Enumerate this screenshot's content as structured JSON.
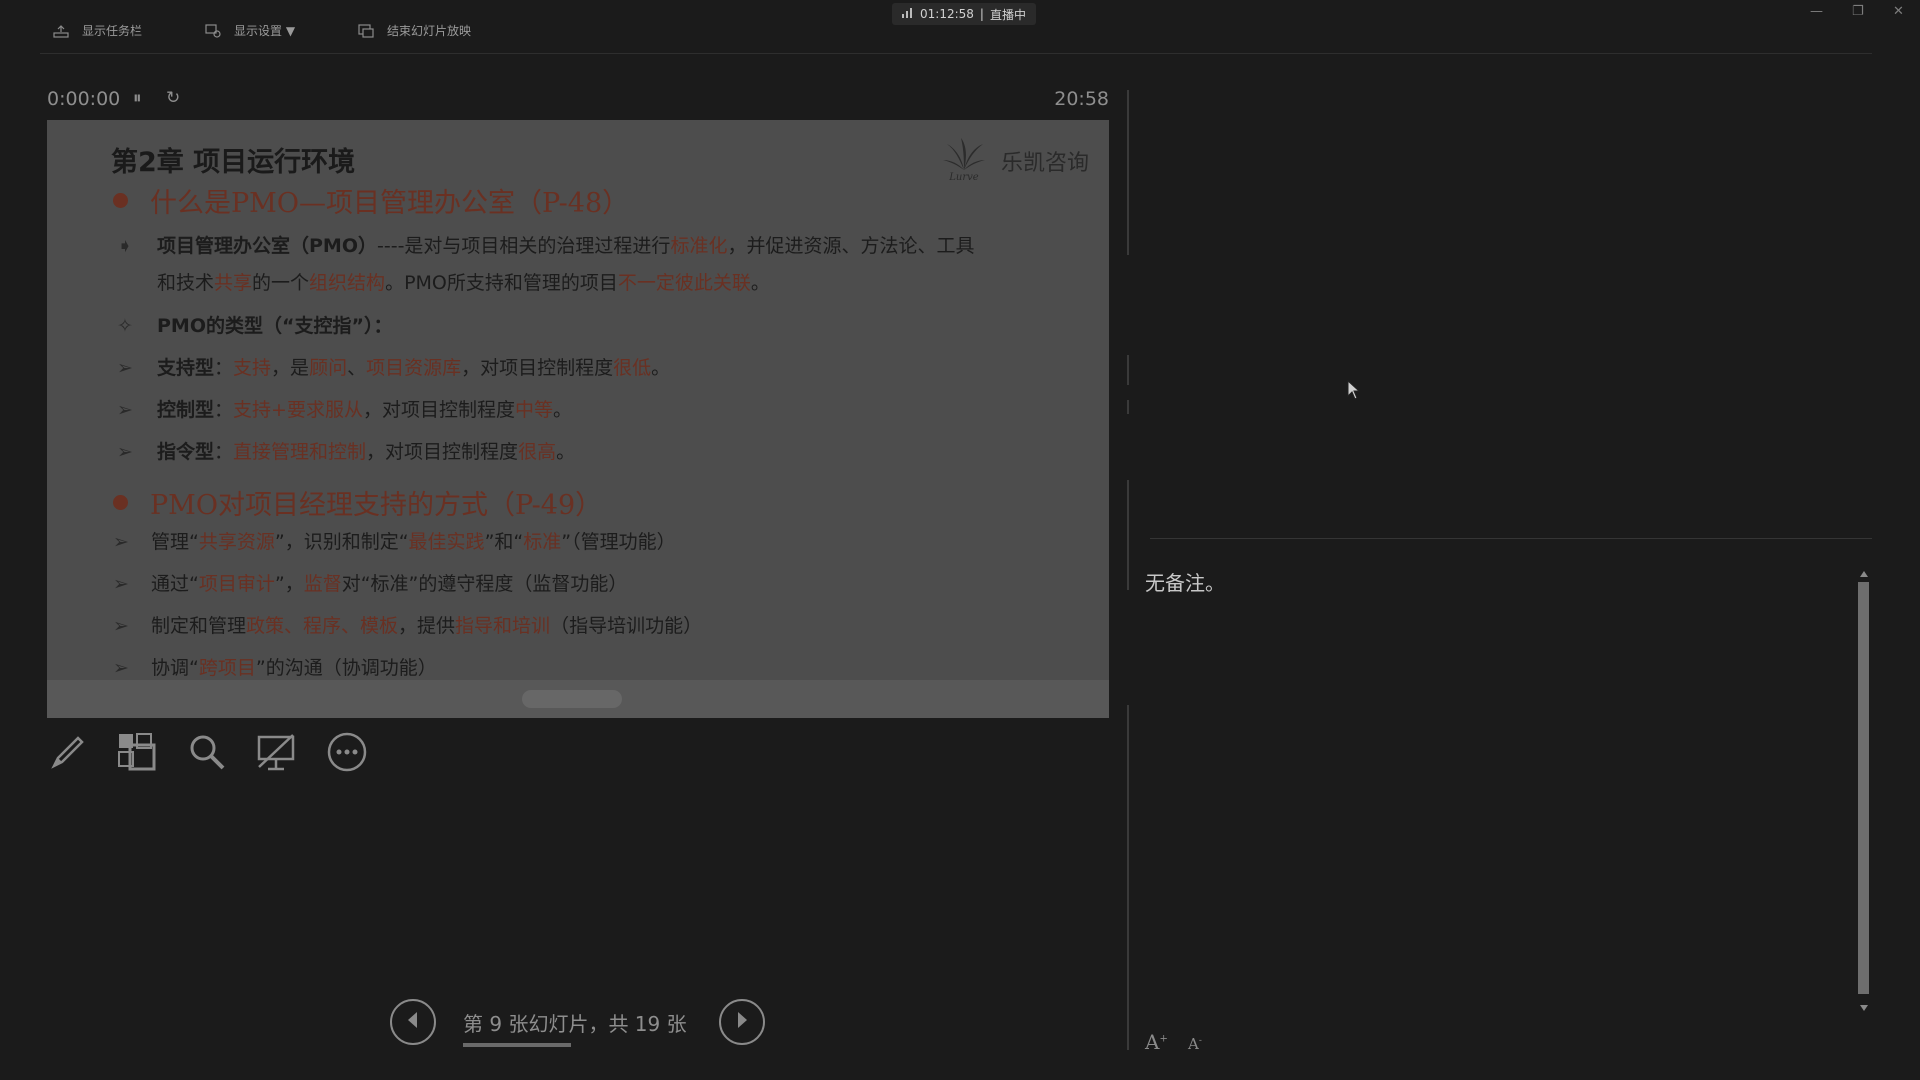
{
  "toolbar": {
    "show_taskbar": "显示任务栏",
    "display_settings": "显示设置 ▼",
    "end_slideshow": "结束幻灯片放映"
  },
  "status": {
    "live_time": "01:12:58",
    "separator": "|",
    "live_label": "直播中"
  },
  "timer": {
    "elapsed": "0:00:00",
    "pause_glyph": "⏸",
    "reset_glyph": "↻",
    "clock": "20:58"
  },
  "slide": {
    "title": "第2章 项目运行环境",
    "logo_text": "乐凯咨询",
    "logo_caption": "Lurve",
    "section1": "什么是PMO—项目管理办公室（P-48）",
    "l1a_bold": "项目管理办公室（PMO）",
    "l1a_t1": "----是对与项目相关的治理过程进行",
    "l1a_h1": "标准化",
    "l1a_t2": "，并促进资源、方法论、工具",
    "l1b_t1": "和技术",
    "l1b_h1": "共享",
    "l1b_t2": "的一个",
    "l1b_h2": "组织结构",
    "l1b_t3": "。PMO所支持和管理的项目",
    "l1b_h3": "不一定彼此关联",
    "l1b_t4": "。",
    "l2_bold": "PMO的类型（“支控指”）：",
    "l3_bold": "支持型",
    "l3_t1": "：",
    "l3_h1": "支持",
    "l3_t2": "，是",
    "l3_h2": "顾问",
    "l3_t3": "、",
    "l3_h3": "项目资源库",
    "l3_t4": "，对项目控制程度",
    "l3_h4": "很低",
    "l3_t5": "。",
    "l4_bold": "控制型",
    "l4_t1": "：",
    "l4_h1": "支持+要求服从",
    "l4_t2": "，对项目控制程度",
    "l4_h2": "中等",
    "l4_t3": "。",
    "l5_bold": "指令型",
    "l5_t1": "：",
    "l5_h1": "直接管理和控制",
    "l5_t2": "，对项目控制程度",
    "l5_h2": "很高",
    "l5_t3": "。",
    "section2": "PMO对项目经理支持的方式（P-49）",
    "l6_t1": "管理“",
    "l6_h1": "共享资源",
    "l6_t2": "”，识别和制定“",
    "l6_h2": "最佳实践",
    "l6_t3": "”和“",
    "l6_h3": "标准",
    "l6_t4": "”（管理功能）",
    "l7_t1": "通过“",
    "l7_h1": "项目审计",
    "l7_t2": "”，",
    "l7_h2": "监督",
    "l7_t3": "对“标准”的遵守程度（监督功能）",
    "l8_t1": "制定和管理",
    "l8_h1": "政策、程序、模板",
    "l8_t2": "，提供",
    "l8_h2": "指导和培训",
    "l8_t3": "（指导培训功能）",
    "l9_t1": "协调“",
    "l9_h1": "跨项目",
    "l9_t2": "”的沟通（协调功能）"
  },
  "navigation": {
    "counter": "第 9 张幻灯片，共 19 张",
    "current": 9,
    "total": 19
  },
  "notes": {
    "text": "无备注。"
  },
  "font_controls": {
    "increase": "A",
    "decrease": "A"
  },
  "icons": [
    "pen-icon",
    "grid-icon",
    "zoom-icon",
    "black-screen-icon",
    "more-icon",
    "prev-arrow-icon",
    "next-arrow-icon"
  ],
  "colors": {
    "background": "#1b1b1b",
    "slide_dimmed": "#4d4d4d",
    "accent_red": "#6a3022"
  }
}
